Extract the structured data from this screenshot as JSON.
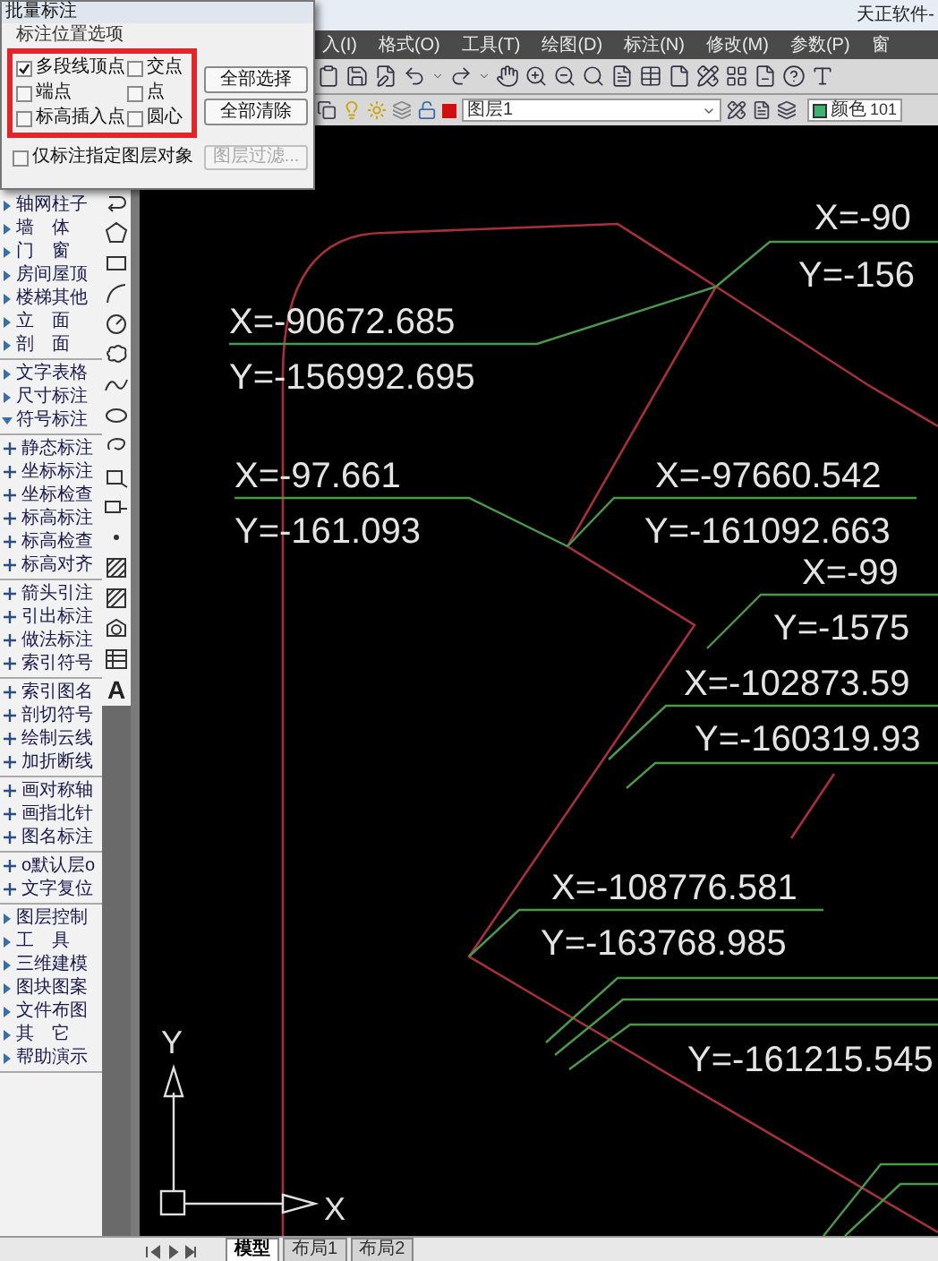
{
  "title_bar": {
    "title": "天正软件-"
  },
  "menu": [
    "入(I)",
    "格式(O)",
    "工具(T)",
    "绘图(D)",
    "标注(N)",
    "修改(M)",
    "参数(P)",
    "窗"
  ],
  "layer_bar": {
    "layer": "图层1",
    "color_label": "颜色",
    "color_value": "101"
  },
  "dialog": {
    "title": "批量标注",
    "group_label": "标注位置选项",
    "options": [
      {
        "label": "多段线顶点",
        "checked": true
      },
      {
        "label": "交点",
        "checked": false
      },
      {
        "label": "端点",
        "checked": false
      },
      {
        "label": "点",
        "checked": false
      },
      {
        "label": "标高插入点",
        "checked": false
      },
      {
        "label": "圆心",
        "checked": false
      }
    ],
    "buttons": [
      "全部选择",
      "全部清除"
    ],
    "layer_only": {
      "label": "仅标注指定图层对象",
      "checked": false
    },
    "filter_button": {
      "label": "图层过滤...",
      "disabled": true
    }
  },
  "sidebar": {
    "groups": [
      [
        {
          "label": "轴网柱子",
          "kind": "menu",
          "expanded": false
        },
        {
          "label": "墙　体",
          "kind": "menu",
          "expanded": false
        },
        {
          "label": "门　窗",
          "kind": "menu",
          "expanded": false
        },
        {
          "label": "房间屋顶",
          "kind": "menu",
          "expanded": false
        },
        {
          "label": "楼梯其他",
          "kind": "menu",
          "expanded": false
        },
        {
          "label": "立　面",
          "kind": "menu",
          "expanded": false
        },
        {
          "label": "剖　面",
          "kind": "menu",
          "expanded": false
        }
      ],
      [
        {
          "label": "文字表格",
          "kind": "menu",
          "expanded": false
        },
        {
          "label": "尺寸标注",
          "kind": "menu",
          "expanded": false
        },
        {
          "label": "符号标注",
          "kind": "menu",
          "expanded": true
        }
      ],
      [
        {
          "label": "静态标注",
          "kind": "command"
        },
        {
          "label": "坐标标注",
          "kind": "command"
        },
        {
          "label": "坐标检查",
          "kind": "command"
        },
        {
          "label": "标高标注",
          "kind": "command"
        },
        {
          "label": "标高检查",
          "kind": "command"
        },
        {
          "label": "标高对齐",
          "kind": "command"
        }
      ],
      [
        {
          "label": "箭头引注",
          "kind": "command"
        },
        {
          "label": "引出标注",
          "kind": "command"
        },
        {
          "label": "做法标注",
          "kind": "command"
        },
        {
          "label": "索引符号",
          "kind": "command"
        }
      ],
      [
        {
          "label": "索引图名",
          "kind": "command"
        },
        {
          "label": "剖切符号",
          "kind": "command"
        },
        {
          "label": "绘制云线",
          "kind": "command"
        },
        {
          "label": "加折断线",
          "kind": "command"
        }
      ],
      [
        {
          "label": "画对称轴",
          "kind": "command"
        },
        {
          "label": "画指北针",
          "kind": "command"
        },
        {
          "label": "图名标注",
          "kind": "command"
        }
      ],
      [
        {
          "label": "o默认层o",
          "kind": "command"
        },
        {
          "label": "文字复位",
          "kind": "command"
        }
      ],
      [
        {
          "label": "图层控制",
          "kind": "menu",
          "expanded": false
        },
        {
          "label": "工　具",
          "kind": "menu",
          "expanded": false
        },
        {
          "label": "三维建模",
          "kind": "menu",
          "expanded": false
        },
        {
          "label": "图块图案",
          "kind": "menu",
          "expanded": false
        },
        {
          "label": "文件布图",
          "kind": "menu",
          "expanded": false
        },
        {
          "label": "其　它",
          "kind": "menu",
          "expanded": false
        },
        {
          "label": "帮助演示",
          "kind": "menu",
          "expanded": false
        }
      ]
    ]
  },
  "draw_toolbar": {
    "text_tool": "A"
  },
  "canvas": {
    "labels": [
      "X=-90",
      "Y=-156",
      "X=-90672.685",
      "Y=-156992.695",
      "X=-97.661",
      "X=-97660.542",
      "Y=-161.093",
      "Y=-161092.663",
      "X=-99",
      "Y=-1575",
      "X=-102873.59",
      "Y=-160319.93",
      "X=-108776.581",
      "Y=-163768.985",
      "Y=-161215.545"
    ],
    "axis_labels": [
      "Y",
      "X"
    ]
  },
  "layout_tabs": [
    {
      "label": "模型",
      "selected": true
    },
    {
      "label": "布局1",
      "selected": false
    },
    {
      "label": "布局2",
      "selected": false
    }
  ]
}
